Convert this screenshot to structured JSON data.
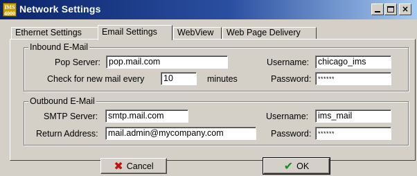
{
  "window": {
    "title": "Network Settings",
    "app_icon_text": "IMS\n4000",
    "controls": {
      "minimize": "minimize",
      "maximize": "maximize",
      "close": "×"
    }
  },
  "tabs": [
    {
      "label": "Ethernet Settings",
      "active": false
    },
    {
      "label": "Email Settings",
      "active": true
    },
    {
      "label": "WebView",
      "active": false
    },
    {
      "label": "Web Page Delivery",
      "active": false
    }
  ],
  "inbound": {
    "legend": "Inbound E-Mail",
    "pop_server_label": "Pop Server:",
    "pop_server_value": "pop.mail.com",
    "check_label": "Check for new mail every",
    "check_value": "10",
    "check_unit": "minutes",
    "username_label": "Username:",
    "username_value": "chicago_ims",
    "password_label": "Password:",
    "password_value": "******"
  },
  "outbound": {
    "legend": "Outbound E-Mail",
    "smtp_label": "SMTP Server:",
    "smtp_value": "smtp.mail.com",
    "return_label": "Return Address:",
    "return_value": "mail.admin@mycompany.com",
    "username_label": "Username:",
    "username_value": "ims_mail",
    "password_label": "Password:",
    "password_value": "******"
  },
  "buttons": {
    "cancel_label": "Cancel",
    "cancel_icon": "x-icon",
    "ok_label": "OK",
    "ok_icon": "checkmark-icon"
  },
  "colors": {
    "titlebar_start": "#0a246a",
    "titlebar_end": "#a6caf0",
    "face": "#d4d0c8",
    "cancel_icon": "#c01010",
    "ok_icon": "#109020"
  }
}
